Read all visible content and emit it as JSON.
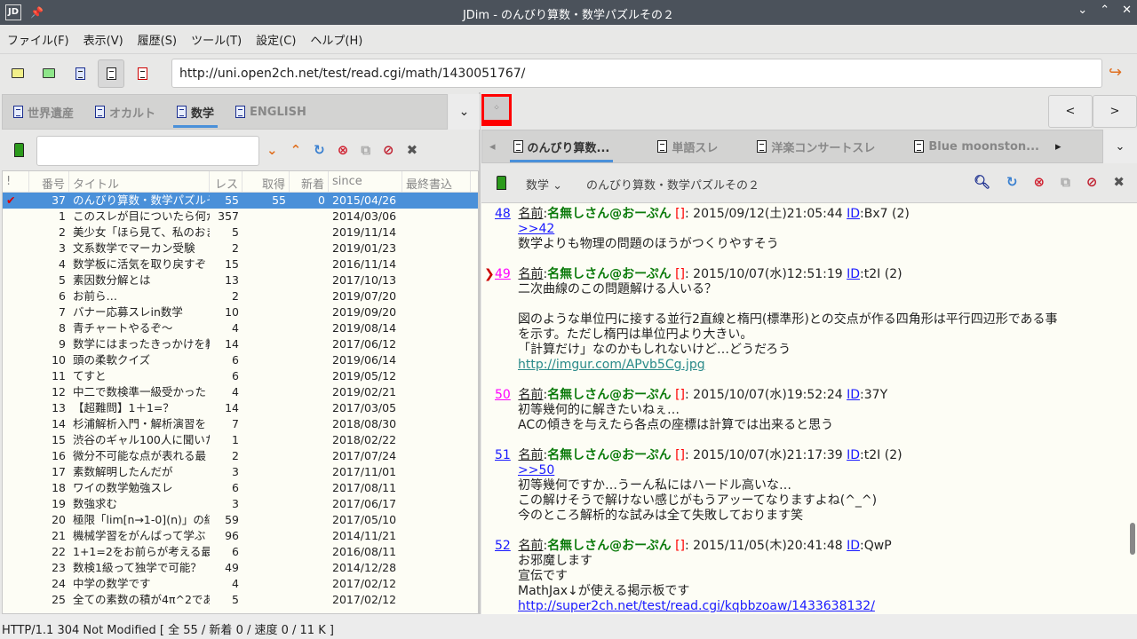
{
  "window": {
    "title": "JDim - のんびり算数・数学パズルその２",
    "logo": "JDim"
  },
  "menu": [
    "ファイル(F)",
    "表示(V)",
    "履歴(S)",
    "ツール(T)",
    "設定(C)",
    "ヘルプ(H)"
  ],
  "toolbar": {
    "url": "http://uni.open2ch.net/test/read.cgi/math/1430051767/"
  },
  "board_tabs": [
    {
      "label": "世界遺産"
    },
    {
      "label": "オカルト"
    },
    {
      "label": "数学",
      "active": true
    },
    {
      "label": "ENGLISH"
    }
  ],
  "thread_list": {
    "search_placeholder": "",
    "columns": [
      "!",
      "番号",
      "タイトル",
      "レス",
      "取得",
      "新着",
      "since",
      "最終書込"
    ],
    "rows": [
      [
        "✔",
        "37",
        "のんびり算数・数学パズルそ",
        "55",
        "55",
        "0",
        "2015/04/26",
        ""
      ],
      [
        "",
        "1",
        "このスレが目についたら何か",
        "357",
        "",
        "",
        "2014/03/06",
        ""
      ],
      [
        "",
        "2",
        "美少女「ほら見て、私のおま",
        "5",
        "",
        "",
        "2019/11/14",
        ""
      ],
      [
        "",
        "3",
        "文系数学でマーカン受験",
        "2",
        "",
        "",
        "2019/01/23",
        ""
      ],
      [
        "",
        "4",
        "数学板に活気を取り戻すぞ",
        "15",
        "",
        "",
        "2016/11/14",
        ""
      ],
      [
        "",
        "5",
        "素因数分解とは",
        "13",
        "",
        "",
        "2017/10/13",
        ""
      ],
      [
        "",
        "6",
        "お前ら…",
        "2",
        "",
        "",
        "2019/07/20",
        ""
      ],
      [
        "",
        "7",
        "バナー応募スレin数学",
        "10",
        "",
        "",
        "2019/09/20",
        ""
      ],
      [
        "",
        "8",
        "青チャートやるぞ～",
        "4",
        "",
        "",
        "2019/08/14",
        ""
      ],
      [
        "",
        "9",
        "数学にはまったきっかけを教",
        "14",
        "",
        "",
        "2017/06/12",
        ""
      ],
      [
        "",
        "10",
        "頭の柔軟クイズ",
        "6",
        "",
        "",
        "2019/06/14",
        ""
      ],
      [
        "",
        "11",
        "てすと",
        "6",
        "",
        "",
        "2019/05/12",
        ""
      ],
      [
        "",
        "12",
        "中二で数検準一級受かった",
        "4",
        "",
        "",
        "2019/02/21",
        ""
      ],
      [
        "",
        "13",
        "【超難問】1＋1=？",
        "14",
        "",
        "",
        "2017/03/05",
        ""
      ],
      [
        "",
        "14",
        "杉浦解析入門・解析演習を",
        "7",
        "",
        "",
        "2018/08/30",
        ""
      ],
      [
        "",
        "15",
        "渋谷のギャル100人に聞いた",
        "1",
        "",
        "",
        "2018/02/22",
        ""
      ],
      [
        "",
        "16",
        "微分不可能な点が表れる最",
        "2",
        "",
        "",
        "2017/07/24",
        ""
      ],
      [
        "",
        "17",
        "素数解明したんだが",
        "3",
        "",
        "",
        "2017/11/01",
        ""
      ],
      [
        "",
        "18",
        "ワイの数学勉強スレ",
        "6",
        "",
        "",
        "2017/08/11",
        ""
      ],
      [
        "",
        "19",
        "数強求む",
        "3",
        "",
        "",
        "2017/06/17",
        ""
      ],
      [
        "",
        "20",
        "極限「lim[n→1-0](n)」の結果",
        "59",
        "",
        "",
        "2017/05/10",
        ""
      ],
      [
        "",
        "21",
        "機械学習をがんばって学ぶ",
        "96",
        "",
        "",
        "2014/11/21",
        ""
      ],
      [
        "",
        "22",
        "1+1=2をお前らが考える最も",
        "6",
        "",
        "",
        "2016/08/11",
        ""
      ],
      [
        "",
        "23",
        "数検1級って独学で可能？",
        "49",
        "",
        "",
        "2014/12/28",
        ""
      ],
      [
        "",
        "24",
        "中学の数学です",
        "4",
        "",
        "",
        "2017/02/12",
        ""
      ],
      [
        "",
        "25",
        "全ての素数の積が4π^2であ",
        "5",
        "",
        "",
        "2017/02/12",
        ""
      ]
    ]
  },
  "thread_tabs": [
    {
      "label": "のんびり算数...",
      "active": true
    },
    {
      "label": "単語スレ"
    },
    {
      "label": "洋楽コンサートスレ"
    },
    {
      "label": "Blue moonston..."
    }
  ],
  "nav": {
    "prev": "<",
    "next": ">"
  },
  "thread_toolbar": {
    "board": "数学",
    "title": "のんびり算数・数学パズルその２"
  },
  "posts": [
    {
      "num": "48",
      "name_label": "名前",
      "name": "名無しさん@おーぷん",
      "mail": "[]",
      "date": ": 2015/09/12(土)21:05:44 ",
      "id_label": "ID",
      "id": ":Bx7 (2)",
      "lines": [
        {
          "text": ">>42",
          "link": true
        },
        {
          "text": "数学よりも物理の問題のほうがつくりやすそう"
        }
      ]
    },
    {
      "num": "49",
      "current": true,
      "name_label": "名前",
      "name": "名無しさん@おーぷん",
      "mail": "[]",
      "date": ": 2015/10/07(水)12:51:19 ",
      "id_label": "ID",
      "id": ":t2I (2)",
      "lines": [
        {
          "text": "二次曲線のこの問題解ける人いる？"
        },
        {
          "text": ""
        },
        {
          "text": "図のような単位円に接する並行2直線と楕円(標準形)との交点が作る四角形は平行四辺形である事"
        },
        {
          "text": "を示す。ただし楕円は単位円より大きい。"
        },
        {
          "text": "「計算だけ」なのかもしれないけど…どうだろう"
        },
        {
          "text": "http://imgur.com/APvb5Cg.jpg",
          "link": true,
          "teal": true
        }
      ]
    },
    {
      "num": "50",
      "name_label": "名前",
      "name": "名無しさん@おーぷん",
      "mail": "[]",
      "date": ": 2015/10/07(水)19:52:24 ",
      "id_label": "ID",
      "id": ":37Y",
      "lines": [
        {
          "text": "初等幾何的に解きたいねぇ…"
        },
        {
          "text": "ACの傾きを与えたら各点の座標は計算では出来ると思う"
        }
      ]
    },
    {
      "num": "51",
      "name_label": "名前",
      "name": "名無しさん@おーぷん",
      "mail": "[]",
      "date": ": 2015/10/07(水)21:17:39 ",
      "id_label": "ID",
      "id": ":t2I (2)",
      "lines": [
        {
          "text": ">>50",
          "link": true
        },
        {
          "text": "初等幾何ですか…うーん私にはハードル高いな…"
        },
        {
          "text": "この解けそうで解けない感じがもうアッーてなりますよね(^_^)"
        },
        {
          "text": "今のところ解析的な試みは全て失敗しております笑"
        }
      ]
    },
    {
      "num": "52",
      "name_label": "名前",
      "name": "名無しさん@おーぷん",
      "mail": "[]",
      "date": ": 2015/11/05(木)20:41:48 ",
      "id_label": "ID",
      "id": ":QwP",
      "lines": [
        {
          "text": "お邪魔します"
        },
        {
          "text": "宣伝です"
        },
        {
          "text": "MathJax↓が使える掲示板です"
        },
        {
          "text": "http://super2ch.net/test/read.cgi/kqbbzoaw/1433638132/",
          "link": true
        }
      ]
    }
  ],
  "status": "HTTP/1.1 304 Not Modified [ 全 55 / 新着 0 / 速度 0 / 11 K ]",
  "colors": {
    "selection": "#4a90d9",
    "name": "#0a7a0a",
    "link": "#1a1aff",
    "titlebar": "#4b525b"
  }
}
